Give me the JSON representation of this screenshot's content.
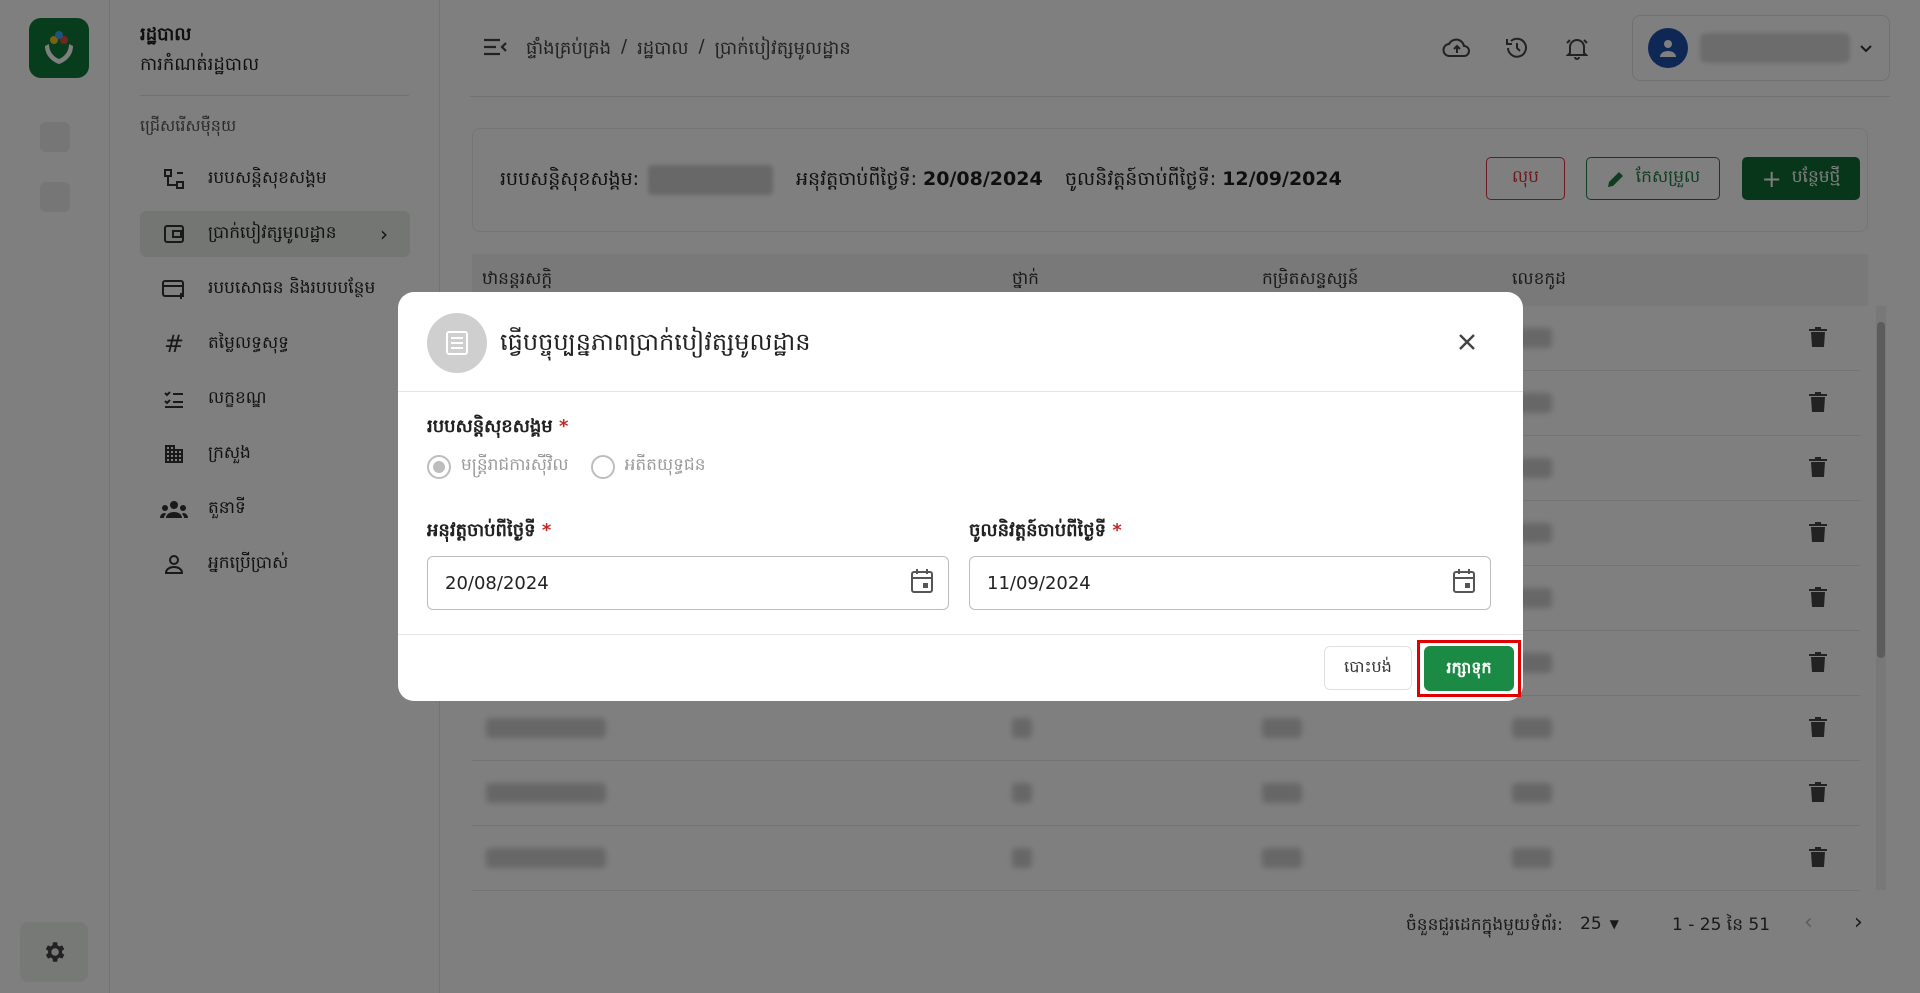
{
  "sidebar": {
    "title": "រដ្ឋបាល",
    "subtitle": "ការកំណត់រដ្ឋបាល",
    "section_label": "ជ្រើសរើសម៉ឺនុយ",
    "items": [
      {
        "label": "របបសន្តិសុខសង្គម",
        "icon": "hierarchy-icon"
      },
      {
        "label": "ប្រាក់បៀវត្សមូលដ្ឋាន",
        "icon": "wallet-icon",
        "active": true
      },
      {
        "label": "របបសោធន និងរបបបន្ថែម",
        "icon": "card-add-icon"
      },
      {
        "label": "តម្លៃលទ្ធសុទ្ធ",
        "icon": "hash-icon"
      },
      {
        "label": "លក្ខខណ្ឌ",
        "icon": "checklist-icon"
      },
      {
        "label": "ក្រសួង",
        "icon": "building-icon"
      },
      {
        "label": "តួនាទី",
        "icon": "group-icon"
      },
      {
        "label": "អ្នកប្រើប្រាស់",
        "icon": "person-icon"
      }
    ]
  },
  "breadcrumb": [
    "ផ្ទាំងគ្រប់គ្រង",
    "/",
    "រដ្ឋបាល",
    "/",
    "ប្រាក់បៀវត្សមូលដ្ឋាន"
  ],
  "summary": {
    "scheme_label": "របបសន្តិសុខសង្គម:",
    "approved_label": "អនុវត្តចាប់ពីថ្ងៃទី:",
    "approved_value": "20/08/2024",
    "effective_label": "ចូលនិវត្តន៍ចាប់ពីថ្ងៃទី:",
    "effective_value": "12/09/2024",
    "delete_label": "លុប",
    "edit_label": "កែសម្រួល",
    "add_label": "បន្ថែមថ្មី"
  },
  "table": {
    "headers": [
      "ឋានន្តរសក្តិ",
      "ថ្នាក់",
      "កម្រិតសន្ទស្សន៍",
      "លេខកូដ"
    ]
  },
  "pagination": {
    "rows_per_page_label": "ចំនួនជួរដេកក្នុងមួយទំព័រ:",
    "rows_per_page": "25",
    "range": "1 - 25 នៃ 51"
  },
  "modal": {
    "title": "ធ្វើបច្ចុប្បន្នភាពប្រាក់បៀវត្សមូលដ្ឋាន",
    "scheme_label": "របបសន្តិសុខសង្គម",
    "option_civil": "មន្ត្រីរាជការស៊ីវិល",
    "option_veteran": "អតីតយុទ្ធជន",
    "approved_label": "អនុវត្តចាប់ពីថ្ងៃទី",
    "approved_value": "20/08/2024",
    "effective_label": "ចូលនិវត្តន៍ចាប់ពីថ្ងៃទី",
    "effective_value": "11/09/2024",
    "required_mark": "*",
    "cancel_label": "បោះបង់",
    "save_label": "រក្សាទុក"
  },
  "colors": {
    "brand_green": "#0f6d35",
    "save_green": "#1b8a45",
    "danger_red": "#d33333",
    "avatar_blue": "#1e4fa8"
  }
}
